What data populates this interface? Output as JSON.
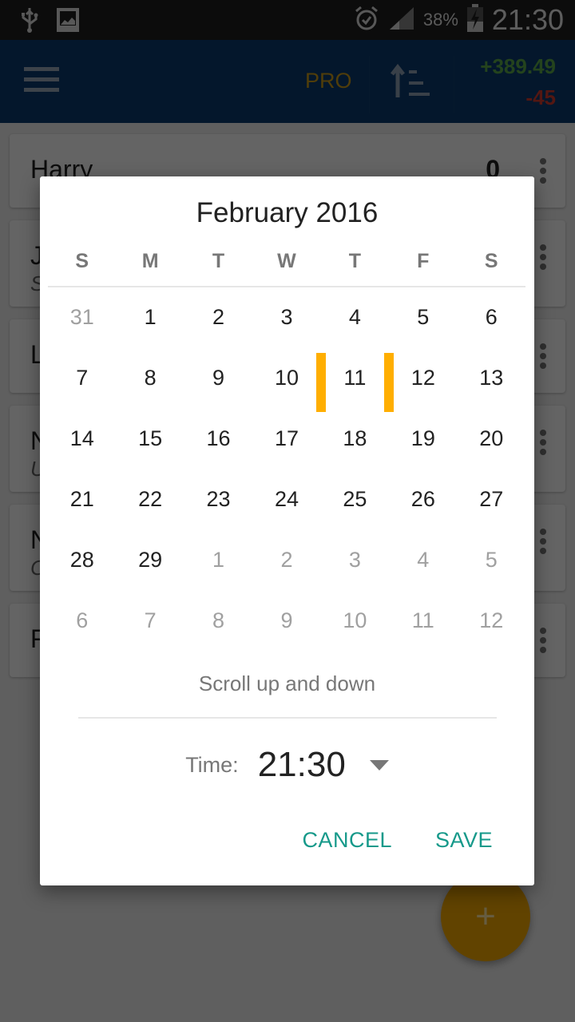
{
  "status_bar": {
    "left_icons": [
      "usb-icon",
      "image-icon"
    ],
    "right_icons": [
      "alarm-icon",
      "signal-icon",
      "battery-charging-icon"
    ],
    "battery_percent": "38%",
    "time": "21:30"
  },
  "app_bar": {
    "menu_icon": "hamburger-menu-icon",
    "pro_label": "PRO",
    "sort_icon": "sort-ascending-icon",
    "total_positive": "+389.49",
    "total_negative": "-45",
    "colors": {
      "background": "#0b3a6e",
      "pro": "#c99a1a",
      "positive": "#5aa94a",
      "negative": "#d03a2f"
    }
  },
  "list": {
    "items": [
      {
        "name": "Harry",
        "subtitle": "",
        "value": "0"
      },
      {
        "name": "J",
        "subtitle": "S",
        "value": ""
      },
      {
        "name": "L",
        "subtitle": "",
        "value": ""
      },
      {
        "name": "N",
        "subtitle": "U",
        "value": ""
      },
      {
        "name": "N",
        "subtitle": "C",
        "value": ""
      },
      {
        "name": "F",
        "subtitle": "",
        "value": ""
      }
    ]
  },
  "fab": {
    "icon": "plus-icon",
    "symbol": "+"
  },
  "dialog": {
    "title": "February 2016",
    "weekdays": [
      "S",
      "M",
      "T",
      "W",
      "T",
      "F",
      "S"
    ],
    "weeks": [
      [
        {
          "d": "31",
          "other": true
        },
        {
          "d": "1"
        },
        {
          "d": "2"
        },
        {
          "d": "3"
        },
        {
          "d": "4"
        },
        {
          "d": "5"
        },
        {
          "d": "6"
        }
      ],
      [
        {
          "d": "7"
        },
        {
          "d": "8"
        },
        {
          "d": "9"
        },
        {
          "d": "10"
        },
        {
          "d": "11",
          "selected": true
        },
        {
          "d": "12"
        },
        {
          "d": "13"
        }
      ],
      [
        {
          "d": "14"
        },
        {
          "d": "15"
        },
        {
          "d": "16"
        },
        {
          "d": "17"
        },
        {
          "d": "18"
        },
        {
          "d": "19"
        },
        {
          "d": "20"
        }
      ],
      [
        {
          "d": "21"
        },
        {
          "d": "22"
        },
        {
          "d": "23"
        },
        {
          "d": "24"
        },
        {
          "d": "25"
        },
        {
          "d": "26"
        },
        {
          "d": "27"
        }
      ],
      [
        {
          "d": "28"
        },
        {
          "d": "29"
        },
        {
          "d": "1",
          "other": true
        },
        {
          "d": "2",
          "other": true
        },
        {
          "d": "3",
          "other": true
        },
        {
          "d": "4",
          "other": true
        },
        {
          "d": "5",
          "other": true
        }
      ],
      [
        {
          "d": "6",
          "other": true
        },
        {
          "d": "7",
          "other": true
        },
        {
          "d": "8",
          "other": true
        },
        {
          "d": "9",
          "other": true
        },
        {
          "d": "10",
          "other": true
        },
        {
          "d": "11",
          "other": true
        },
        {
          "d": "12",
          "other": true
        }
      ]
    ],
    "selected_day": "11",
    "hint": "Scroll up and down",
    "time_label": "Time:",
    "time_value": "21:30",
    "cancel_label": "CANCEL",
    "save_label": "SAVE",
    "colors": {
      "accent": "#16998a",
      "selection": "#ffae00"
    }
  }
}
